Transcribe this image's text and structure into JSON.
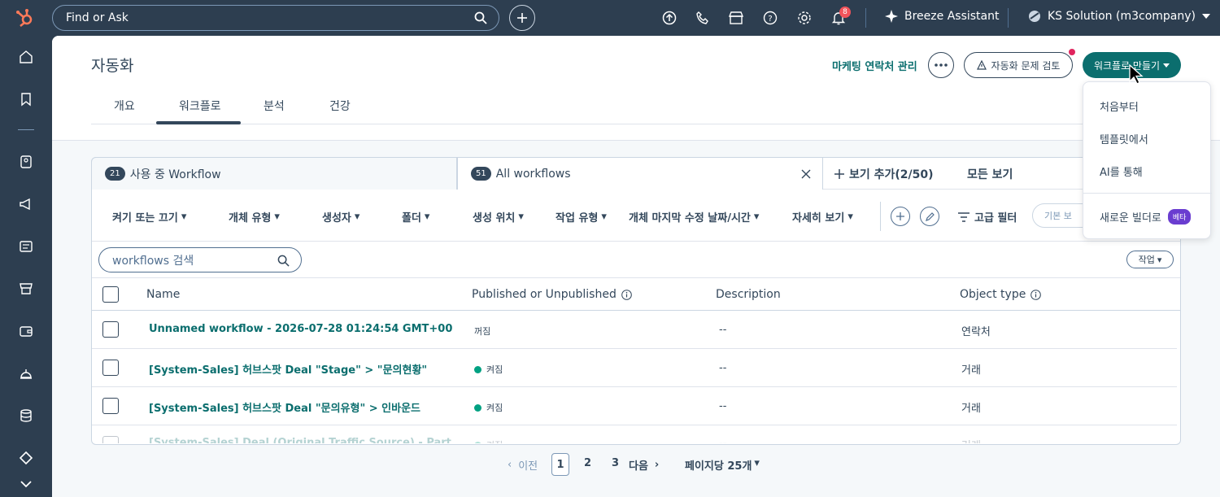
{
  "topbar": {
    "search_placeholder": "Find or Ask",
    "notification_count": "8",
    "breeze_label": "Breeze Assistant",
    "account_label": "KS Solution (m3company)"
  },
  "header": {
    "title": "자동화",
    "marketing_link": "마케팅 연락처 관리",
    "review_button": "자동화 문제 검토",
    "create_button": "워크플로 만들기"
  },
  "tabs": [
    {
      "label": "개요"
    },
    {
      "label": "워크플로"
    },
    {
      "label": "분석"
    },
    {
      "label": "건강"
    }
  ],
  "views": {
    "tab1_count": "21",
    "tab1_label": "사용 중 Workflow",
    "tab2_count": "51",
    "tab2_label": "All workflows",
    "add_view": "보기 추가(2/50)",
    "all_views": "모든 보기"
  },
  "filters": {
    "items": [
      {
        "label": "켜기 또는 끄기"
      },
      {
        "label": "개체 유형"
      },
      {
        "label": "생성자"
      },
      {
        "label": "폴더"
      },
      {
        "label": "생성 위치"
      },
      {
        "label": "작업 유형"
      },
      {
        "label": "개체 마지막 수정 날짜/시간"
      },
      {
        "label": "자세히 보기"
      }
    ],
    "advanced": "고급 필터",
    "preset": "기본 보"
  },
  "table": {
    "search_placeholder": "workflows 검색",
    "action_button": "작업",
    "columns": {
      "name": "Name",
      "published": "Published or Unpublished",
      "description": "Description",
      "object_type": "Object type"
    },
    "rows": [
      {
        "name": "Unnamed workflow - 2026-07-28 01:24:54 GMT+00",
        "status": "꺼짐",
        "description": "--",
        "object_type": "연락처"
      },
      {
        "name": "[System-Sales] 허브스팟 Deal \"Stage\" > \"문의현황\"",
        "status": "켜짐",
        "description": "--",
        "object_type": "거래"
      },
      {
        "name": "[System-Sales] 허브스팟 Deal \"문의유형\" > 인바운드",
        "status": "켜짐",
        "description": "--",
        "object_type": "거래"
      },
      {
        "name": "[System-Sales] Deal (Original Traffic Source) - Part",
        "status": "켜짐",
        "description": "--",
        "object_type": "거래"
      }
    ]
  },
  "pagination": {
    "prev": "이전",
    "page1": "1",
    "page2": "2",
    "page3": "3",
    "next": "다음",
    "per_page": "페이지당 25개"
  },
  "dropdown": {
    "item1": "처음부터",
    "item2": "템플릿에서",
    "item3": "AI를 통해",
    "item4": "새로운 빌더로",
    "beta": "베타"
  },
  "colors": {
    "nav_bg": "#2d3e50",
    "accent": "#0b6e6e",
    "status_on": "#00a182",
    "beta_badge": "#6a3dd0"
  }
}
